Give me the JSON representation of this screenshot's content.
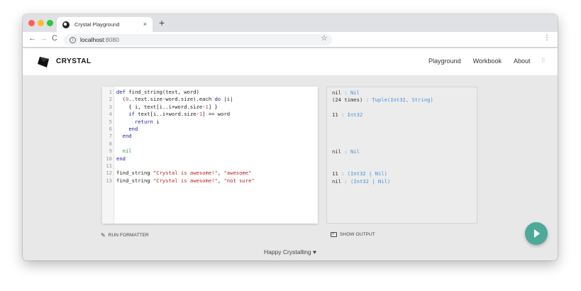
{
  "browser": {
    "tab_title": "Crystal Playground",
    "tab_close": "×",
    "new_tab": "+",
    "url_host": "localhost",
    "url_port": ":8080"
  },
  "header": {
    "brand": "CRYSTAL",
    "nav": [
      {
        "label": "Playground"
      },
      {
        "label": "Workbook"
      },
      {
        "label": "About"
      }
    ]
  },
  "editor": {
    "line_numbers": [
      "1",
      "2",
      "3",
      "4",
      "5",
      "6",
      "7",
      "8",
      "9",
      "10",
      "11",
      "12",
      "13"
    ],
    "lines": [
      [
        {
          "t": "kw",
          "v": "def"
        },
        {
          "t": "",
          "v": " find_string(text, word)"
        }
      ],
      [
        {
          "t": "",
          "v": "  ("
        },
        {
          "t": "num",
          "v": "0"
        },
        {
          "t": "",
          "v": "..text.size-word.size).each "
        },
        {
          "t": "kw",
          "v": "do"
        },
        {
          "t": "",
          "v": " |i|"
        }
      ],
      [
        {
          "t": "",
          "v": "    { i, text[i..i+word.size-"
        },
        {
          "t": "num",
          "v": "1"
        },
        {
          "t": "",
          "v": "] }"
        }
      ],
      [
        {
          "t": "",
          "v": "    "
        },
        {
          "t": "kw",
          "v": "if"
        },
        {
          "t": "",
          "v": " text[i..i+word.size-"
        },
        {
          "t": "num",
          "v": "1"
        },
        {
          "t": "",
          "v": "] == word"
        }
      ],
      [
        {
          "t": "",
          "v": "      "
        },
        {
          "t": "kw",
          "v": "return"
        },
        {
          "t": "",
          "v": " i"
        }
      ],
      [
        {
          "t": "",
          "v": "    "
        },
        {
          "t": "kw",
          "v": "end"
        }
      ],
      [
        {
          "t": "",
          "v": "  "
        },
        {
          "t": "kw",
          "v": "end"
        }
      ],
      [],
      [
        {
          "t": "",
          "v": "  "
        },
        {
          "t": "nil",
          "v": "nil"
        }
      ],
      [
        {
          "t": "kw",
          "v": "end"
        }
      ],
      [],
      [
        {
          "t": "",
          "v": "find_string "
        },
        {
          "t": "str",
          "v": "\"Crystal is awesome!\""
        },
        {
          "t": "",
          "v": ", "
        },
        {
          "t": "str",
          "v": "\"awesome\""
        }
      ],
      [
        {
          "t": "",
          "v": "find_string "
        },
        {
          "t": "str",
          "v": "\"Crystal is awesome!\""
        },
        {
          "t": "",
          "v": ", "
        },
        {
          "t": "str",
          "v": "\"not sure\""
        }
      ]
    ]
  },
  "output": {
    "lines": [
      {
        "value": "nil",
        "type": " : Nil"
      },
      {
        "value": "(24 times)",
        "type": " : Tuple(Int32, String)"
      },
      {
        "value": "",
        "type": ""
      },
      {
        "value": "11",
        "type": " : Int32"
      },
      {
        "value": "",
        "type": ""
      },
      {
        "value": "",
        "type": ""
      },
      {
        "value": "",
        "type": ""
      },
      {
        "value": "",
        "type": ""
      },
      {
        "value": "nil",
        "type": " : Nil"
      },
      {
        "value": "",
        "type": ""
      },
      {
        "value": "",
        "type": ""
      },
      {
        "value": "11",
        "type": " : (Int32 | Nil)"
      },
      {
        "value": "nil",
        "type": " : (Int32 | Nil)"
      }
    ]
  },
  "actions": {
    "run_formatter": "RUN FORMATTER",
    "show_output": "SHOW OUTPUT"
  },
  "footer": "Happy Crystalling ♥"
}
